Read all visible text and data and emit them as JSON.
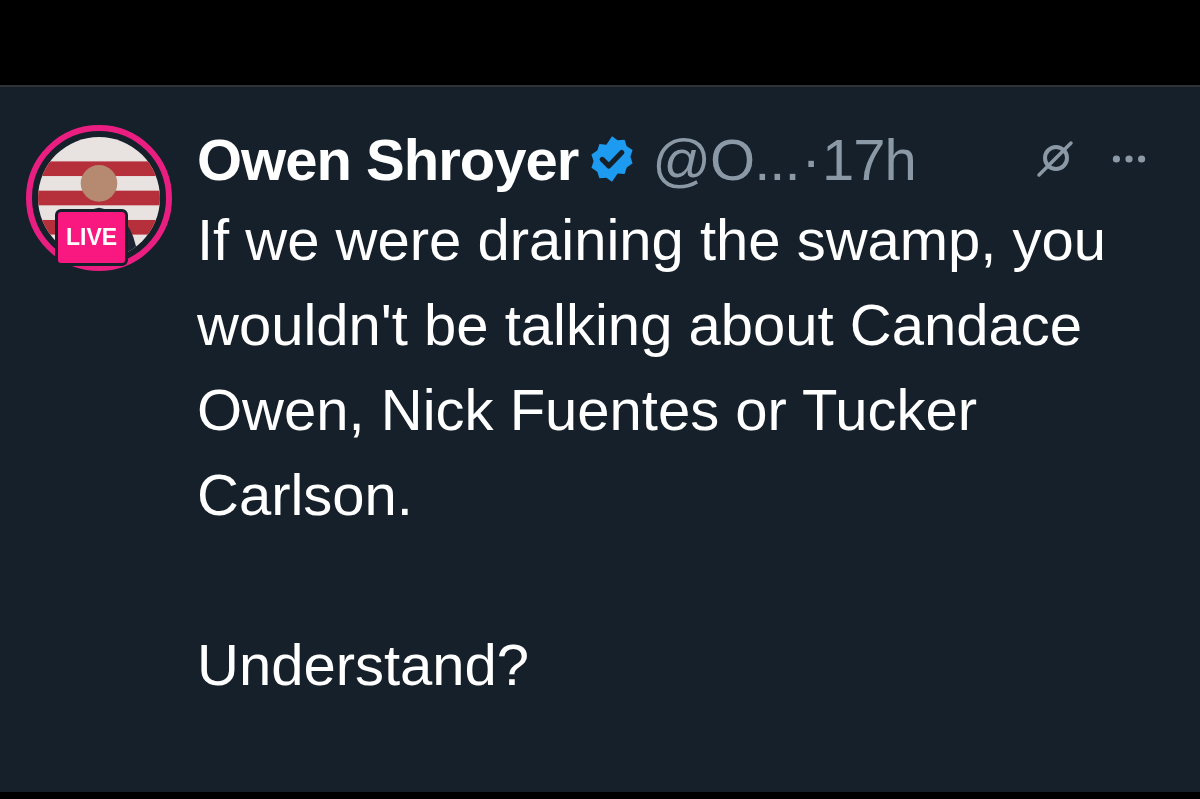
{
  "post": {
    "author": {
      "name": "Owen Shroyer",
      "verified": true,
      "handle": "@O...",
      "live_badge": "LIVE"
    },
    "separator": "·",
    "time": "17h",
    "body": [
      "If we were draining the swamp, you wouldn't be talking about Candace Owen, Nick Fuentes or Tucker Carlson.",
      "Understand?"
    ]
  }
}
